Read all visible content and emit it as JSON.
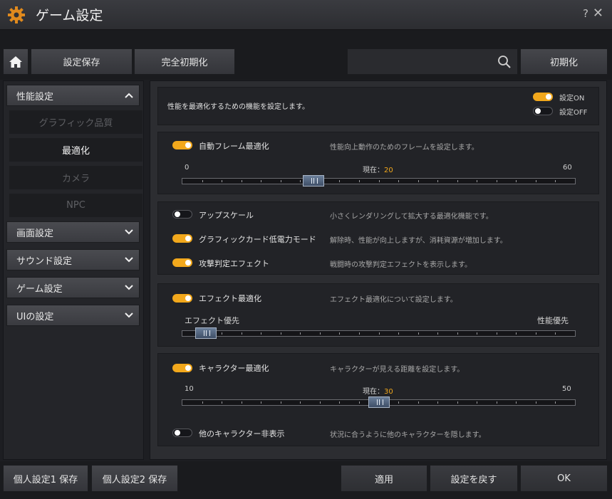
{
  "window": {
    "title": "ゲーム設定",
    "help": "?",
    "close": "✕",
    "icon": "gear-icon"
  },
  "toolbar": {
    "home_icon": "home-icon",
    "save": "設定保存",
    "reset_all": "完全初期化",
    "search": {
      "value": "",
      "placeholder": ""
    },
    "search_icon": "search-icon",
    "init": "初期化"
  },
  "sidebar": {
    "performance": {
      "label": "性能設定",
      "expanded": true,
      "items": [
        {
          "label": "グラフィック品質",
          "active": false
        },
        {
          "label": "最適化",
          "active": true
        },
        {
          "label": "カメラ",
          "active": false
        },
        {
          "label": "NPC",
          "active": false
        }
      ]
    },
    "screen": {
      "label": "画面設定"
    },
    "sound": {
      "label": "サウンド設定"
    },
    "game": {
      "label": "ゲーム設定"
    },
    "ui": {
      "label": "UIの設定"
    }
  },
  "header": {
    "text": "性能を最適化するための機能を設定します。",
    "legend_on": "設定ON",
    "legend_off": "設定OFF"
  },
  "frame": {
    "label": "自動フレーム最適化",
    "on": true,
    "desc": "性能向上動作のためのフレームを設定します。",
    "min": "0",
    "max": "60",
    "current_label": "現在：",
    "current": "20",
    "value": 20,
    "range": [
      0,
      60
    ]
  },
  "toggles": [
    {
      "label": "アップスケール",
      "on": false,
      "desc": "小さくレンダリングして拡大する最適化機能です。"
    },
    {
      "label": "グラフィックカード低電力モード",
      "on": true,
      "desc": "解除時、性能が向上しますが、消耗資源が増加します。"
    },
    {
      "label": "攻撃判定エフェクト",
      "on": true,
      "desc": "戦闘時の攻撃判定エフェクトを表示します。"
    }
  ],
  "effect": {
    "label": "エフェクト最適化",
    "on": true,
    "desc": "エフェクト最適化について設定します。",
    "left": "エフェクト優先",
    "right": "性能優先",
    "value": 0.06
  },
  "character": {
    "label": "キャラクター最適化",
    "on": true,
    "desc": "キャラクターが見える距離を設定します。",
    "min": "10",
    "max": "50",
    "current_label": "現在：",
    "current": "30",
    "value": 30,
    "range": [
      10,
      50
    ],
    "hide_label": "他のキャラクター非表示",
    "hide_on": false,
    "hide_desc": "状況に合うように他のキャラクターを隠します。"
  },
  "footer": {
    "preset1": "個人設定1 保存",
    "preset2": "個人設定2 保存",
    "apply": "適用",
    "revert": "設定を戻す",
    "ok": "OK"
  }
}
